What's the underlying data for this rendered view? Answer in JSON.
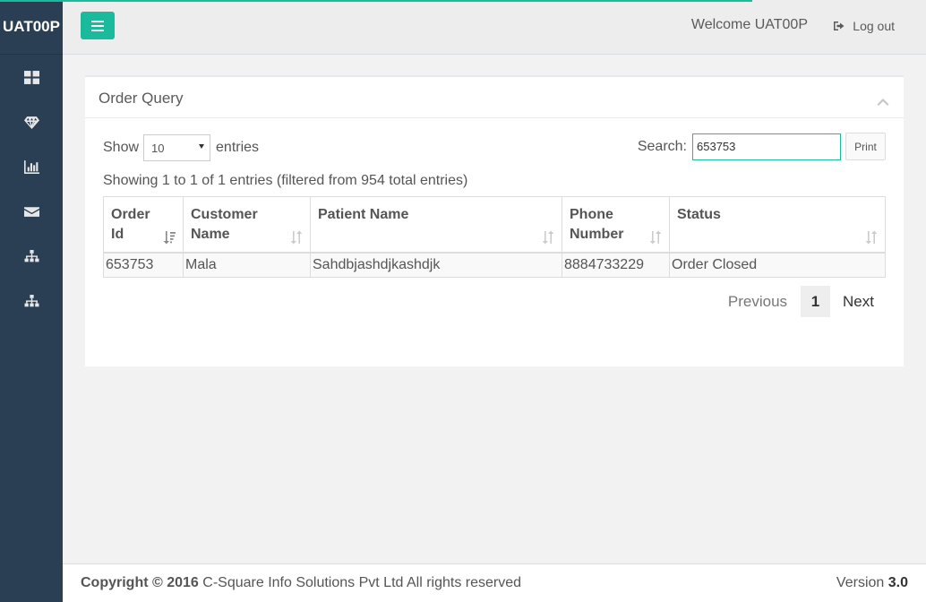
{
  "brand": "UAT00P",
  "header": {
    "welcome": "Welcome UAT00P",
    "logout_label": "Log out"
  },
  "sidebar": {
    "icons": [
      "dashboard-icon",
      "diamond-icon",
      "bar-chart-icon",
      "envelope-icon",
      "sitemap-icon",
      "sitemap-icon"
    ]
  },
  "panel": {
    "title": "Order Query"
  },
  "table_controls": {
    "show_label": "Show",
    "page_size": "10",
    "entries_label": "entries",
    "search_label": "Search:",
    "search_value": "653753",
    "print_label": "Print",
    "info": "Showing 1 to 1 of 1 entries (filtered from 954 total entries)"
  },
  "table": {
    "columns": [
      {
        "label": "Order Id"
      },
      {
        "label": "Customer Name"
      },
      {
        "label": "Patient Name"
      },
      {
        "label": "Phone Number"
      },
      {
        "label": "Status"
      }
    ],
    "rows": [
      [
        "653753",
        "Mala",
        "Sahdbjashdjkashdjk",
        "8884733229",
        "Order Closed"
      ]
    ]
  },
  "pagination": {
    "previous": "Previous",
    "current": "1",
    "next": "Next"
  },
  "footer": {
    "copyright_bold": "Copyright © 2016",
    "copyright_rest": "C-Square Info Solutions Pvt Ltd All rights reserved",
    "version_label": "Version",
    "version_number": "3.0"
  },
  "colors": {
    "accent": "#1abb9c",
    "sidebar": "#2a3f54"
  }
}
